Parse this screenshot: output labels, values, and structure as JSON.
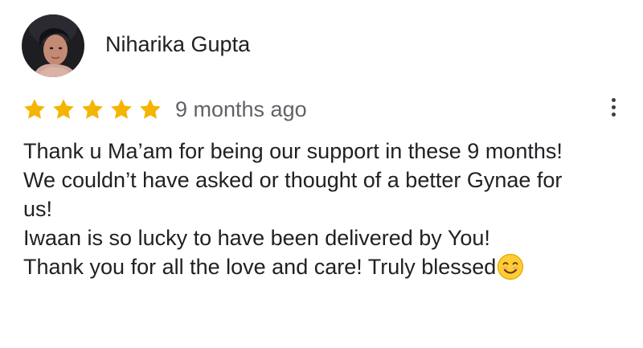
{
  "review": {
    "reviewer_name": "Niharika Gupta",
    "rating": 5,
    "rating_max": 5,
    "timestamp": "9 months ago",
    "text_lines": [
      "Thank u Ma’am for being our support in these 9 months!",
      "We couldn’t have asked or thought of a better Gynae for",
      "us!",
      "Iwaan is so lucky to have been delivered by You!",
      "Thank you for all the love and care! Truly blessed"
    ],
    "trailing_emoji": "smiling-face-emoji"
  },
  "icons": {
    "star": "star-icon",
    "more": "more-vert-icon"
  },
  "colors": {
    "star": "#f4b400",
    "name_text": "#202124",
    "meta_text": "#5f6368",
    "body_text": "#202124"
  }
}
